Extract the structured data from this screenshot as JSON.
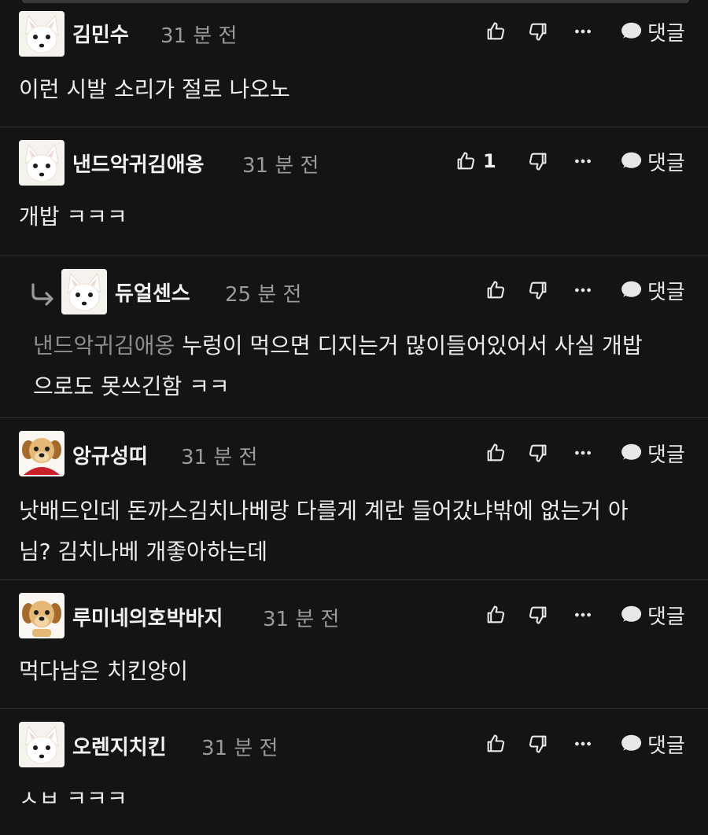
{
  "reply_label": "댓글",
  "comments": [
    {
      "author": "김민수",
      "time": "31 분 전",
      "avatar": "white-fox-avatar",
      "likes": "",
      "text": "이런 시발 소리가 절로 나오노"
    },
    {
      "author": "낸드악귀김애옹",
      "time": "31 분 전",
      "avatar": "white-fox-avatar",
      "likes": "1",
      "text": "개밥 ㅋㅋㅋ"
    },
    {
      "author": "듀얼센스",
      "time": "25 분 전",
      "avatar": "white-fox-avatar",
      "is_reply": true,
      "mention": "낸드악귀김애옹",
      "text_line1": "누렁이 먹으면 디지는거 많이들어있어서 사실 개밥",
      "text_line2": "으로도 못쓰긴함 ㅋㅋ"
    },
    {
      "author": "앙규성띠",
      "time": "31 분 전",
      "avatar": "puppy-red-cape-avatar",
      "text_line1": "낫배드인데 돈까스김치나베랑 다를게 계란 들어갔냐밖에 없는거 아",
      "text_line2": "님? 김치나베 개좋아하는데"
    },
    {
      "author": "루미네의호박바지",
      "time": "31 분 전",
      "avatar": "puppy-avatar",
      "text": "먹다남은 치킨양이"
    },
    {
      "author": "오렌지치킨",
      "time": "31 분 전",
      "avatar": "white-fox-avatar",
      "text": "ㅅㅂ ㅋㅋㅋ"
    }
  ],
  "colors": {
    "background": "#141414",
    "divider": "#333333",
    "text": "#ececec",
    "muted": "#9a9a9a",
    "mention": "#8e8e8e"
  }
}
